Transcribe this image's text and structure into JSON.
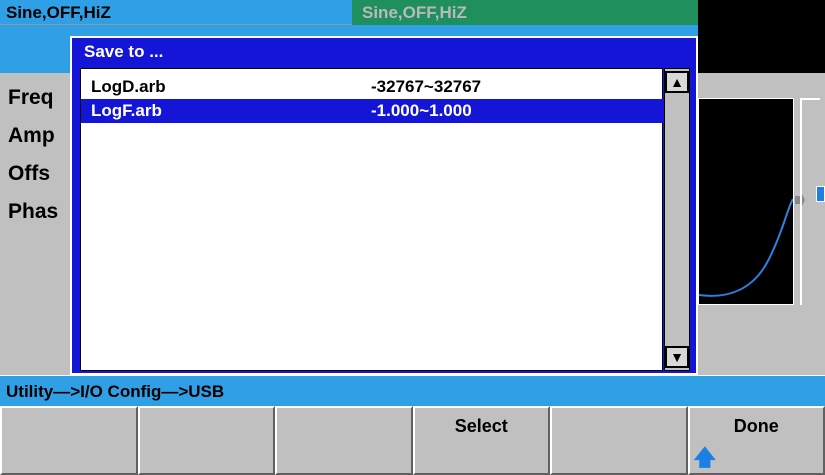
{
  "status": {
    "ch1_tab": "Sine,OFF,HiZ",
    "ch2_tab": "Sine,OFF,HiZ"
  },
  "params": [
    "Freq",
    "Amp",
    "Offs",
    "Phas"
  ],
  "dialog": {
    "title": "Save to ...",
    "files": [
      {
        "name": "LogD.arb",
        "range": "-32767~32767",
        "selected": false
      },
      {
        "name": "LogF.arb",
        "range": "-1.000~1.000",
        "selected": true
      }
    ]
  },
  "path": "Utility—>I/O Config—>USB",
  "softkeys": [
    "",
    "",
    "",
    "Select",
    "",
    "Done"
  ],
  "icons": {
    "scroll_up": "scroll-up-arrow-icon",
    "scroll_down": "scroll-down-arrow-icon",
    "return": "up-arrow-icon"
  },
  "colors": {
    "accent_blue": "#2fa0e6",
    "dialog_blue": "#1515d8",
    "ch2_green": "#1f8f5e",
    "panel_gray": "#c0c0c0"
  }
}
